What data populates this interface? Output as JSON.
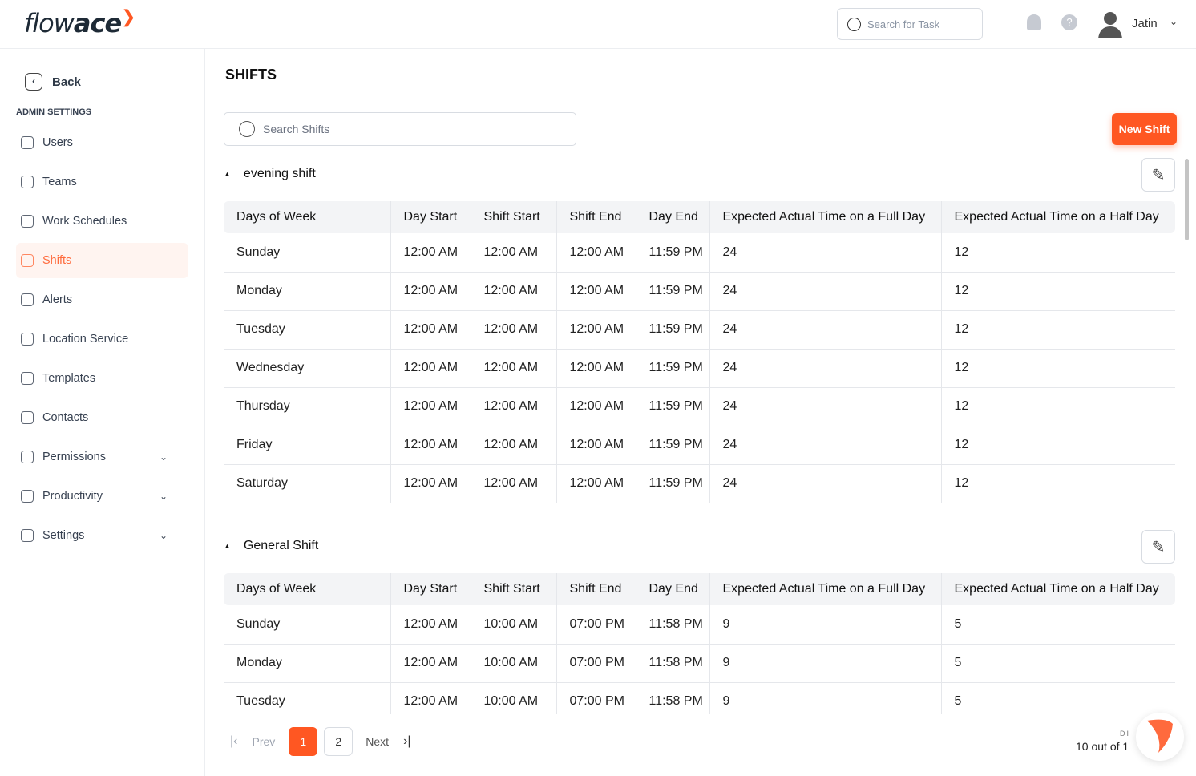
{
  "header": {
    "logo_light": "flow",
    "logo_bold": "ace",
    "search_placeholder": "Search for Task",
    "user_name": "Jatin"
  },
  "sidebar": {
    "back": "Back",
    "section": "ADMIN SETTINGS",
    "items": [
      {
        "label": "Users",
        "icon": "user-icon"
      },
      {
        "label": "Teams",
        "icon": "users-icon"
      },
      {
        "label": "Work Schedules",
        "icon": "calendar-icon"
      },
      {
        "label": "Shifts",
        "icon": "shift-icon",
        "active": true
      },
      {
        "label": "Alerts",
        "icon": "alert-icon"
      },
      {
        "label": "Location Service",
        "icon": "location-icon"
      },
      {
        "label": "Templates",
        "icon": "folder-icon"
      },
      {
        "label": "Contacts",
        "icon": "contact-icon"
      },
      {
        "label": "Permissions",
        "icon": "lock-icon",
        "expandable": true
      },
      {
        "label": "Productivity",
        "icon": "productivity-icon",
        "expandable": true
      },
      {
        "label": "Settings",
        "icon": "settings-icon",
        "expandable": true
      }
    ]
  },
  "main": {
    "title": "SHIFTS",
    "search_placeholder": "Search Shifts",
    "new_button": "New Shift",
    "columns": [
      "Days of Week",
      "Day Start",
      "Shift Start",
      "Shift End",
      "Day End",
      "Expected Actual Time on a Full Day",
      "Expected Actual Time on a Half Day"
    ],
    "shifts": [
      {
        "name": "evening shift",
        "rows": [
          [
            "Sunday",
            "12:00 AM",
            "12:00 AM",
            "12:00 AM",
            "11:59 PM",
            "24",
            "12"
          ],
          [
            "Monday",
            "12:00 AM",
            "12:00 AM",
            "12:00 AM",
            "11:59 PM",
            "24",
            "12"
          ],
          [
            "Tuesday",
            "12:00 AM",
            "12:00 AM",
            "12:00 AM",
            "11:59 PM",
            "24",
            "12"
          ],
          [
            "Wednesday",
            "12:00 AM",
            "12:00 AM",
            "12:00 AM",
            "11:59 PM",
            "24",
            "12"
          ],
          [
            "Thursday",
            "12:00 AM",
            "12:00 AM",
            "12:00 AM",
            "11:59 PM",
            "24",
            "12"
          ],
          [
            "Friday",
            "12:00 AM",
            "12:00 AM",
            "12:00 AM",
            "11:59 PM",
            "24",
            "12"
          ],
          [
            "Saturday",
            "12:00 AM",
            "12:00 AM",
            "12:00 AM",
            "11:59 PM",
            "24",
            "12"
          ]
        ]
      },
      {
        "name": "General Shift",
        "rows": [
          [
            "Sunday",
            "12:00 AM",
            "10:00 AM",
            "07:00 PM",
            "11:58 PM",
            "9",
            "5"
          ],
          [
            "Monday",
            "12:00 AM",
            "10:00 AM",
            "07:00 PM",
            "11:58 PM",
            "9",
            "5"
          ],
          [
            "Tuesday",
            "12:00 AM",
            "10:00 AM",
            "07:00 PM",
            "11:58 PM",
            "9",
            "5"
          ]
        ]
      }
    ]
  },
  "pagination": {
    "prev": "Prev",
    "next": "Next",
    "pages": [
      "1",
      "2"
    ],
    "current": "1",
    "count_text": "10 out of 1",
    "label_partial": "DI"
  },
  "colors": {
    "accent": "#ff5722",
    "active_bg": "#fff4f0"
  }
}
